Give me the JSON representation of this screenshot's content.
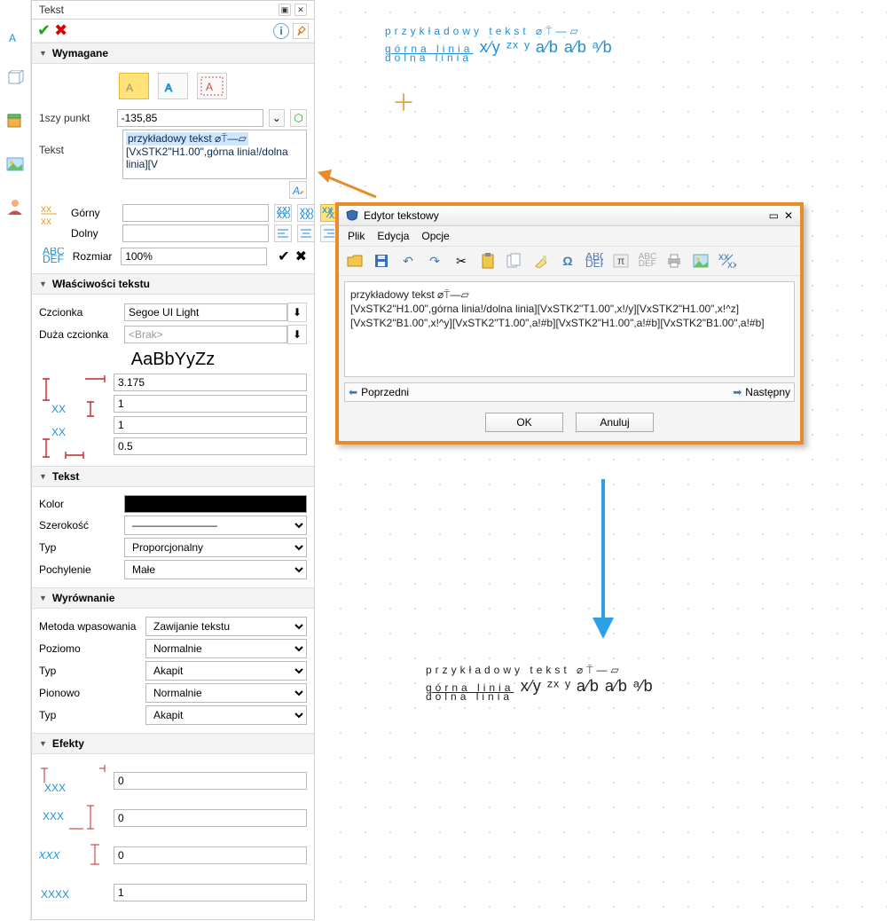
{
  "panel": {
    "title": "Tekst",
    "sections": {
      "required": "Wymagane",
      "textprops": "Właściwości tekstu",
      "text": "Tekst",
      "align": "Wyrównanie",
      "effects": "Efekty"
    },
    "first_point_label": "1szy punkt",
    "first_point_value": "-135,85",
    "tekst_label": "Tekst",
    "tekst_line1": "przykładowy tekst ⌀⍑—▱",
    "tekst_line2": "[VxSTK2\"H1.00\",górna linia!/dolna linia][V",
    "upper_label": "Górny",
    "lower_label": "Dolny",
    "size_label": "Rozmiar",
    "size_value": "100%",
    "font_label": "Czcionka",
    "font_value": "Segoe UI Light",
    "bigfont_label": "Duża czcionka",
    "bigfont_value": "<Brak>",
    "sample": "AaBbYyZz",
    "spacing": {
      "v1": "3.175",
      "v2": "1",
      "v3": "1",
      "v4": "0.5"
    },
    "color_label": "Kolor",
    "width_label": "Szerokość",
    "type_label": "Typ",
    "type_value": "Proporcjonalny",
    "slant_label": "Pochylenie",
    "slant_value": "Małe",
    "fit_label": "Metoda wpasowania",
    "fit_value": "Zawijanie tekstu",
    "horiz_label": "Poziomo",
    "horiz_value": "Normalnie",
    "align_type1_value": "Akapit",
    "vert_label": "Pionowo",
    "vert_value": "Normalnie",
    "align_type2_value": "Akapit",
    "effects": {
      "e1": "0",
      "e2": "0",
      "e3": "0",
      "e4": "1"
    }
  },
  "editor": {
    "title": "Edytor tekstowy",
    "menu": {
      "file": "Plik",
      "edit": "Edycja",
      "options": "Opcje"
    },
    "body_l1": "przykładowy tekst ⌀⍑—▱",
    "body_l2": "[VxSTK2\"H1.00\",górna linia!/dolna linia][VxSTK2\"T1.00\",x!/y][VxSTK2\"H1.00\",x!^z]",
    "body_l3": "[VxSTK2\"B1.00\",x!^y][VxSTK2\"T1.00\",a!#b][VxSTK2\"H1.00\",a!#b][VxSTK2\"B1.00\",a!#b]",
    "prev": "Poprzedni",
    "next": "Następny",
    "ok": "OK",
    "cancel": "Anuluj"
  },
  "canvas": {
    "blue_l1": "przykładowy tekst ⌀⍑—▱",
    "blue_top": "górna linia",
    "blue_bot": "dolna linia",
    "frac_tail": "x⁄y ᶻˣ ʸ a⁄b a⁄b ᵃ⁄b",
    "black_l1": "przykładowy tekst ⌀⍑—▱",
    "black_top": "górna linia",
    "black_bot": "dolna linia"
  }
}
